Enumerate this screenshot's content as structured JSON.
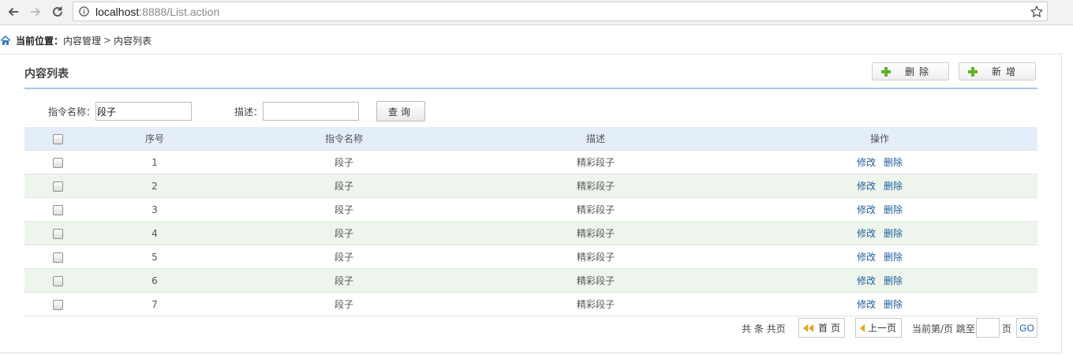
{
  "browser": {
    "url_host": "localhost",
    "url_rest": ":8888/List.action"
  },
  "breadcrumb": {
    "prefix": "当前位置：",
    "items": [
      "内容管理",
      "内容列表"
    ],
    "separator": ">"
  },
  "panel": {
    "title": "内容列表",
    "buttons": {
      "delete": "删除",
      "add": "新增"
    }
  },
  "search": {
    "command_label": "指令名称：",
    "command_value": "段子",
    "desc_label": "描述：",
    "desc_value": "",
    "query_button": "查询"
  },
  "table": {
    "headers": [
      "序号",
      "指令名称",
      "描述",
      "操作"
    ],
    "rows": [
      {
        "id": "1",
        "command": "段子",
        "description": "精彩段子",
        "edit": "修改",
        "delete": "删除"
      },
      {
        "id": "2",
        "command": "段子",
        "description": "精彩段子",
        "edit": "修改",
        "delete": "删除"
      },
      {
        "id": "3",
        "command": "段子",
        "description": "精彩段子",
        "edit": "修改",
        "delete": "删除"
      },
      {
        "id": "4",
        "command": "段子",
        "description": "精彩段子",
        "edit": "修改",
        "delete": "删除"
      },
      {
        "id": "5",
        "command": "段子",
        "description": "精彩段子",
        "edit": "修改",
        "delete": "删除"
      },
      {
        "id": "6",
        "command": "段子",
        "description": "精彩段子",
        "edit": "修改",
        "delete": "删除"
      },
      {
        "id": "7",
        "command": "段子",
        "description": "精彩段子",
        "edit": "修改",
        "delete": "删除"
      }
    ]
  },
  "pager": {
    "summary": "共 条 共页",
    "first": "首 页",
    "prev": "上一页",
    "current": "当前第/页 跳至",
    "page_unit": "页",
    "go": "GO"
  },
  "colors": {
    "header_bg": "#e4eef9",
    "alt_row_bg": "#edf5ed",
    "link": "#1f5d9c",
    "plus_icon": "#5fb328",
    "pager_arrow": "#e8a317"
  },
  "icons": [
    "back-arrow-icon",
    "forward-arrow-icon",
    "reload-icon",
    "info-icon",
    "star-icon",
    "home-icon",
    "plus-icon",
    "first-page-icon",
    "prev-page-icon"
  ]
}
